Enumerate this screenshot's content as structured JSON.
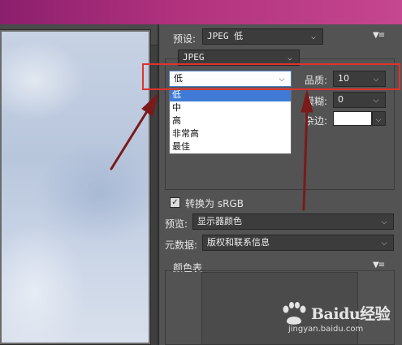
{
  "settings": {
    "preset_label": "预设:",
    "preset_value": "JPEG 低",
    "format_value": "JPEG",
    "compression_value": "低",
    "quality_label": "品质:",
    "quality_value": "10",
    "blur_label": "模糊:",
    "blur_value": "0",
    "matte_label": "杂边:",
    "convert_srgb_label": "转换为 sRGB",
    "convert_srgb_checked": true,
    "preview_label": "预览:",
    "preview_value": "显示器颜色",
    "metadata_label": "元数据:",
    "metadata_value": "版权和联系信息",
    "color_table_label": "颜色表"
  },
  "compression_dropdown": {
    "options": [
      "低",
      "中",
      "高",
      "非常高",
      "最佳"
    ],
    "selected_index": 0
  },
  "icons": {
    "panel_menu": "panel-menu-icon",
    "chevron": "chevron-down-icon",
    "check": "checkmark-icon"
  },
  "colors": {
    "highlight_box": "#e2312c",
    "annotation_arrow": "#7a1a1a",
    "selection": "#3f7bd6"
  },
  "watermark": {
    "brand": "Baidu经验",
    "url": "jingyan.baidu.com"
  }
}
